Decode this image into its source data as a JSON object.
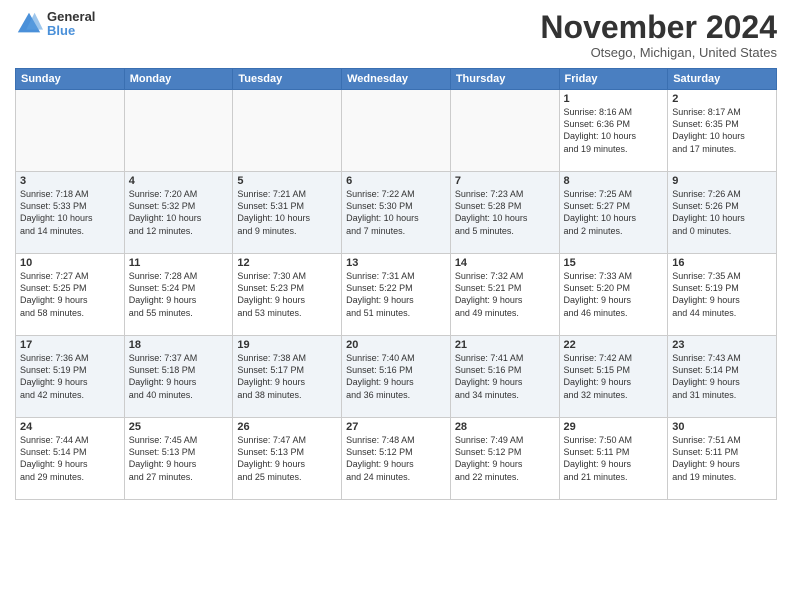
{
  "logo": {
    "general": "General",
    "blue": "Blue"
  },
  "header": {
    "month": "November 2024",
    "location": "Otsego, Michigan, United States"
  },
  "weekdays": [
    "Sunday",
    "Monday",
    "Tuesday",
    "Wednesday",
    "Thursday",
    "Friday",
    "Saturday"
  ],
  "weeks": [
    [
      {
        "day": "",
        "info": ""
      },
      {
        "day": "",
        "info": ""
      },
      {
        "day": "",
        "info": ""
      },
      {
        "day": "",
        "info": ""
      },
      {
        "day": "",
        "info": ""
      },
      {
        "day": "1",
        "info": "Sunrise: 8:16 AM\nSunset: 6:36 PM\nDaylight: 10 hours\nand 19 minutes."
      },
      {
        "day": "2",
        "info": "Sunrise: 8:17 AM\nSunset: 6:35 PM\nDaylight: 10 hours\nand 17 minutes."
      }
    ],
    [
      {
        "day": "3",
        "info": "Sunrise: 7:18 AM\nSunset: 5:33 PM\nDaylight: 10 hours\nand 14 minutes."
      },
      {
        "day": "4",
        "info": "Sunrise: 7:20 AM\nSunset: 5:32 PM\nDaylight: 10 hours\nand 12 minutes."
      },
      {
        "day": "5",
        "info": "Sunrise: 7:21 AM\nSunset: 5:31 PM\nDaylight: 10 hours\nand 9 minutes."
      },
      {
        "day": "6",
        "info": "Sunrise: 7:22 AM\nSunset: 5:30 PM\nDaylight: 10 hours\nand 7 minutes."
      },
      {
        "day": "7",
        "info": "Sunrise: 7:23 AM\nSunset: 5:28 PM\nDaylight: 10 hours\nand 5 minutes."
      },
      {
        "day": "8",
        "info": "Sunrise: 7:25 AM\nSunset: 5:27 PM\nDaylight: 10 hours\nand 2 minutes."
      },
      {
        "day": "9",
        "info": "Sunrise: 7:26 AM\nSunset: 5:26 PM\nDaylight: 10 hours\nand 0 minutes."
      }
    ],
    [
      {
        "day": "10",
        "info": "Sunrise: 7:27 AM\nSunset: 5:25 PM\nDaylight: 9 hours\nand 58 minutes."
      },
      {
        "day": "11",
        "info": "Sunrise: 7:28 AM\nSunset: 5:24 PM\nDaylight: 9 hours\nand 55 minutes."
      },
      {
        "day": "12",
        "info": "Sunrise: 7:30 AM\nSunset: 5:23 PM\nDaylight: 9 hours\nand 53 minutes."
      },
      {
        "day": "13",
        "info": "Sunrise: 7:31 AM\nSunset: 5:22 PM\nDaylight: 9 hours\nand 51 minutes."
      },
      {
        "day": "14",
        "info": "Sunrise: 7:32 AM\nSunset: 5:21 PM\nDaylight: 9 hours\nand 49 minutes."
      },
      {
        "day": "15",
        "info": "Sunrise: 7:33 AM\nSunset: 5:20 PM\nDaylight: 9 hours\nand 46 minutes."
      },
      {
        "day": "16",
        "info": "Sunrise: 7:35 AM\nSunset: 5:19 PM\nDaylight: 9 hours\nand 44 minutes."
      }
    ],
    [
      {
        "day": "17",
        "info": "Sunrise: 7:36 AM\nSunset: 5:19 PM\nDaylight: 9 hours\nand 42 minutes."
      },
      {
        "day": "18",
        "info": "Sunrise: 7:37 AM\nSunset: 5:18 PM\nDaylight: 9 hours\nand 40 minutes."
      },
      {
        "day": "19",
        "info": "Sunrise: 7:38 AM\nSunset: 5:17 PM\nDaylight: 9 hours\nand 38 minutes."
      },
      {
        "day": "20",
        "info": "Sunrise: 7:40 AM\nSunset: 5:16 PM\nDaylight: 9 hours\nand 36 minutes."
      },
      {
        "day": "21",
        "info": "Sunrise: 7:41 AM\nSunset: 5:16 PM\nDaylight: 9 hours\nand 34 minutes."
      },
      {
        "day": "22",
        "info": "Sunrise: 7:42 AM\nSunset: 5:15 PM\nDaylight: 9 hours\nand 32 minutes."
      },
      {
        "day": "23",
        "info": "Sunrise: 7:43 AM\nSunset: 5:14 PM\nDaylight: 9 hours\nand 31 minutes."
      }
    ],
    [
      {
        "day": "24",
        "info": "Sunrise: 7:44 AM\nSunset: 5:14 PM\nDaylight: 9 hours\nand 29 minutes."
      },
      {
        "day": "25",
        "info": "Sunrise: 7:45 AM\nSunset: 5:13 PM\nDaylight: 9 hours\nand 27 minutes."
      },
      {
        "day": "26",
        "info": "Sunrise: 7:47 AM\nSunset: 5:13 PM\nDaylight: 9 hours\nand 25 minutes."
      },
      {
        "day": "27",
        "info": "Sunrise: 7:48 AM\nSunset: 5:12 PM\nDaylight: 9 hours\nand 24 minutes."
      },
      {
        "day": "28",
        "info": "Sunrise: 7:49 AM\nSunset: 5:12 PM\nDaylight: 9 hours\nand 22 minutes."
      },
      {
        "day": "29",
        "info": "Sunrise: 7:50 AM\nSunset: 5:11 PM\nDaylight: 9 hours\nand 21 minutes."
      },
      {
        "day": "30",
        "info": "Sunrise: 7:51 AM\nSunset: 5:11 PM\nDaylight: 9 hours\nand 19 minutes."
      }
    ]
  ]
}
